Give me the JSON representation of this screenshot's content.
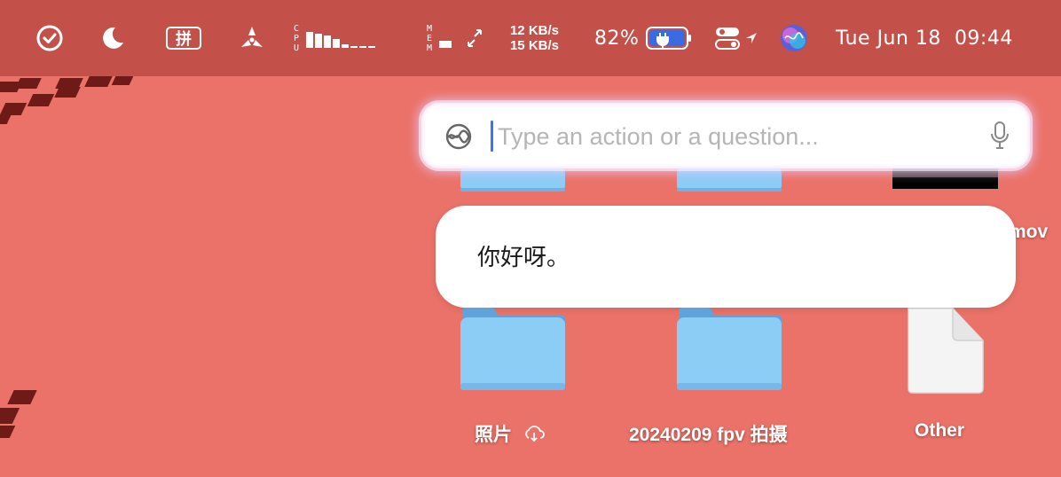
{
  "menubar": {
    "icons": [
      "checkmark-circle-icon",
      "moon-icon",
      "pinyin-input-icon",
      "fan-icon",
      "cpu-meter-icon",
      "mem-meter-icon",
      "network-icon",
      "battery-icon",
      "control-center-icon",
      "location-icon",
      "siri-icon"
    ],
    "pinyin_label": "拼",
    "cpu_label": [
      "C",
      "P",
      "U"
    ],
    "mem_label": [
      "M",
      "E",
      "M"
    ],
    "net_up": "12 KB/s",
    "net_down": "15 KB/s",
    "battery_percent": "82%",
    "battery_level": 0.82,
    "date": "Tue Jun 18",
    "time": "09:44"
  },
  "search": {
    "placeholder": "Type an action or a question...",
    "value": ""
  },
  "response": {
    "text": "你好呀。"
  },
  "desktop": {
    "items": [
      {
        "label": "照片"
      },
      {
        "label": "20240209 fpv 拍摄"
      },
      {
        "label": "Other"
      },
      {
        "label": "mov"
      }
    ]
  },
  "colors": {
    "desktop": "#eb7268",
    "menubar": "#c4504a",
    "folder": "#8ccdf6",
    "caret": "#3478f6"
  }
}
